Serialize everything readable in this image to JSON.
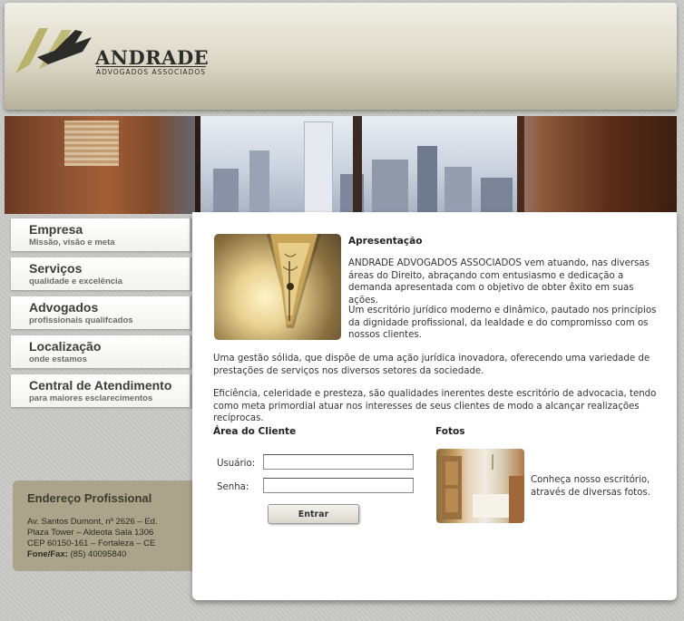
{
  "brand": {
    "name": "ANDRADE",
    "subtitle": "ADVOGADOS ASSOCIADOS",
    "accent": "#b9b26a"
  },
  "menu": {
    "items": [
      {
        "title": "Empresa",
        "subtitle": "Missão, visão e meta"
      },
      {
        "title": "Serviços",
        "subtitle": "qualidade e excelência"
      },
      {
        "title": "Advogados",
        "subtitle": "profissionais qualifcados"
      },
      {
        "title": "Localização",
        "subtitle": "onde estamos"
      },
      {
        "title": "Central de Atendimento",
        "subtitle": "para maiores esclarecimentos"
      }
    ]
  },
  "address": {
    "title": "Endereço Profissional",
    "lines": [
      "Av. Santos Dumont, nº 2626 – Ed.",
      "Plaza Tower – Aldeota Sala 1306",
      "CEP 60150-161 – Fortaleza – CE"
    ],
    "phone_label": "Fone/Fax:",
    "phone": "(85) 40095840"
  },
  "content": {
    "heading": "Apresentação",
    "p1": "ANDRADE ADVOGADOS ASSOCIADOS vem atuando, nas diversas áreas do Direito, abraçando com entusiasmo e dedicação a demanda apresentada com o objetivo de obter êxito em suas ações.",
    "p2": "Um escritório jurídico moderno e dinâmico, pautado nos princípios da dignidade profissional, da lealdade e do compromisso com os nossos clientes.",
    "p3": "Uma gestão sólida, que dispõe de uma ação jurídica inovadora, oferecendo uma variedade de prestações de serviços nos diversos setores da sociedade.",
    "p4": "Eficiência, celeridade e presteza, são qualidades inerentes deste escritório de advocacia, tendo como meta primordial atuar nos interesses de seus clientes de modo a alcançar realizações recíprocas."
  },
  "client_area": {
    "title": "Área do Cliente",
    "user_label": "Usuário:",
    "user_value": "",
    "pass_label": "Senha:",
    "pass_value": "",
    "submit_label": "Entrar"
  },
  "photos": {
    "title": "Fotos",
    "caption": "Conheça nosso escritório, através de diversas fotos."
  }
}
